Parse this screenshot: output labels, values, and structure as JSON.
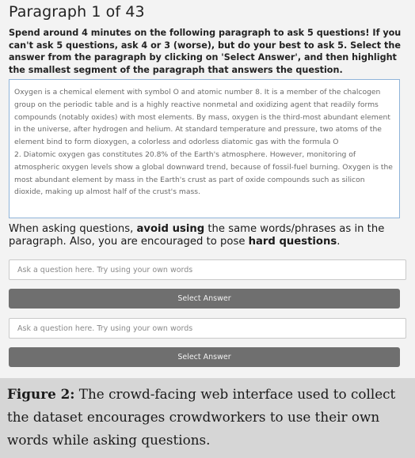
{
  "header": {
    "title": "Paragraph 1 of 43"
  },
  "instructions": "Spend around 4 minutes on the following paragraph to ask 5 questions! If you can't ask 5 questions, ask 4 or 3 (worse), but do your best to ask 5. Select the answer from the paragraph by clicking on 'Select Answer', and then highlight the smallest segment of the paragraph that answers the question.",
  "paragraph": {
    "line1": "Oxygen is a chemical element with symbol O and atomic number 8. It is a member of the chalcogen group on the periodic table and is a highly reactive nonmetal and oxidizing agent that readily forms compounds (notably oxides) with most elements. By mass, oxygen is the third-most abundant element in the universe, after hydrogen and helium. At standard temperature and pressure, two atoms of the element bind to form dioxygen, a colorless and odorless diatomic gas with the formula O",
    "line2": "2. Diatomic oxygen gas constitutes 20.8% of the Earth's atmosphere. However, monitoring of atmospheric oxygen levels show a global downward trend, because of fossil-fuel burning. Oxygen is the most abundant element by mass in the Earth's crust as part of oxide compounds such as silicon dioxide, making up almost half of the crust's mass."
  },
  "guidance": {
    "part1": "When asking questions, ",
    "bold1": "avoid using",
    "part2": " the same words/phrases as in the paragraph. Also, you are encouraged to pose ",
    "bold2": "hard questions",
    "part3": "."
  },
  "questions": [
    {
      "placeholder": "Ask a question here. Try using your own words",
      "value": "",
      "button_label": "Select Answer"
    },
    {
      "placeholder": "Ask a question here. Try using your own words",
      "value": "",
      "button_label": "Select Answer"
    }
  ],
  "caption": {
    "label": "Figure 2:",
    "text": " The crowd-facing web interface used to collect the dataset encourages crowdworkers to use their own words while asking questions."
  }
}
